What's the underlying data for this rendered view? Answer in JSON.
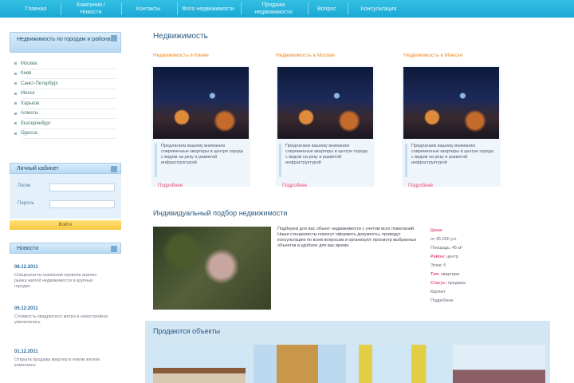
{
  "nav": {
    "items": [
      {
        "label": "Главная"
      },
      {
        "label": "Компания / Новости"
      },
      {
        "label": "Контакты"
      },
      {
        "label": "Фото недвижимости"
      },
      {
        "label": "Продажа недвижимости"
      },
      {
        "label": "Вопрос"
      },
      {
        "label": "Консультация"
      }
    ]
  },
  "sidebar": {
    "categories_title": "Недвижимость по городам и районам",
    "categories": [
      "Москва",
      "Киев",
      "Санкт-Петербург",
      "Минск",
      "Харьков",
      "Алматы",
      "Екатеринбург",
      "Одесса"
    ],
    "login": {
      "title": "Личный кабинет",
      "login_label": "Логин",
      "password_label": "Пароль",
      "button": "Войти"
    },
    "news_title": "Новости",
    "news": [
      {
        "date": "08.12.2011",
        "text": "Специалисты компании провели анализ рынка жилой недвижимости в крупных городах"
      },
      {
        "date": "05.12.2011",
        "text": "Стоимость квадратного метра в новостройках увеличилась"
      },
      {
        "date": "01.12.2011",
        "text": "Открыта продажа квартир в новом жилом комплексе"
      }
    ]
  },
  "main": {
    "title": "Недвижимость",
    "cards": [
      {
        "title": "Недвижимость в Киеве",
        "text": "Предлагаем вашему вниманию современные квартиры в центре города с видом на реку и развитой инфраструктурой",
        "more": "Подробнее"
      },
      {
        "title": "Недвижимость в Москве",
        "text": "Предлагаем вашему вниманию современные квартиры в центре города с видом на реку и развитой инфраструктурой",
        "more": "Подробнее"
      },
      {
        "title": "Недвижимость в Минске",
        "text": "Предлагаем вашему вниманию современные квартиры в центре города с видом на реку и развитой инфраструктурой",
        "more": "Подробнее"
      }
    ],
    "individual": {
      "title": "Индивидуальный подбор недвижимости",
      "text": "Подберем для вас объект недвижимости с учетом всех пожеланий. Наши специалисты помогут оформить документы, проведут консультацию по всем вопросам и организуют просмотр выбранных объектов в удобное для вас время.",
      "details": [
        {
          "label": "Цена:",
          "value": ""
        },
        {
          "label": "",
          "value": "от 35 000 у.е."
        },
        {
          "label": "",
          "value": "Площадь: 45 м²"
        },
        {
          "label": "Район:",
          "value": "центр"
        },
        {
          "label": "",
          "value": "Этаж: 5"
        },
        {
          "label": "Тип:",
          "value": "квартира"
        },
        {
          "label": "Статус:",
          "value": "продажа"
        },
        {
          "label": "",
          "value": "Кирпич"
        },
        {
          "label": "",
          "value": "Подробнее"
        }
      ]
    },
    "ready": {
      "title": "Продаются объекты"
    }
  }
}
